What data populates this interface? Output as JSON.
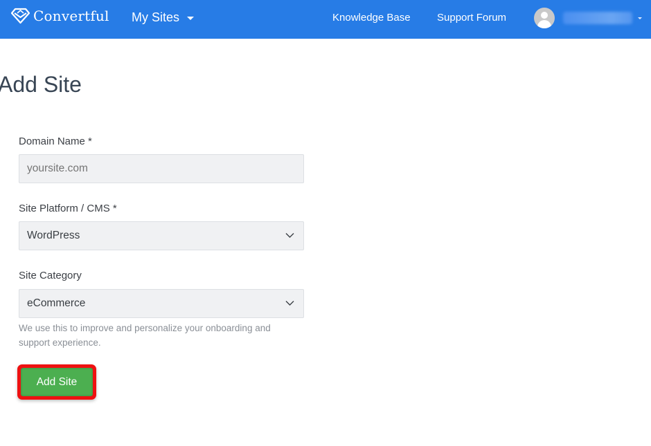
{
  "navbar": {
    "brand_name": "Convertful",
    "brand_icon": "diamond-logo-icon",
    "menu_label": "My Sites",
    "links": [
      "Knowledge Base",
      "Support Forum"
    ],
    "user_avatar_icon": "user-avatar-icon",
    "user_name_redacted": true,
    "background_color": "#277ce6"
  },
  "page": {
    "title": "Add Site"
  },
  "form": {
    "domain": {
      "label": "Domain Name *",
      "value": "",
      "placeholder": "yoursite.com"
    },
    "platform": {
      "label": "Site Platform / CMS *",
      "selected": "WordPress"
    },
    "category": {
      "label": "Site Category",
      "selected": "eCommerce",
      "help": "We use this to improve and personalize your onboarding and support experience."
    },
    "submit_label": "Add Site",
    "submit_color": "#4caf50",
    "highlight_color": "#ee1111"
  }
}
